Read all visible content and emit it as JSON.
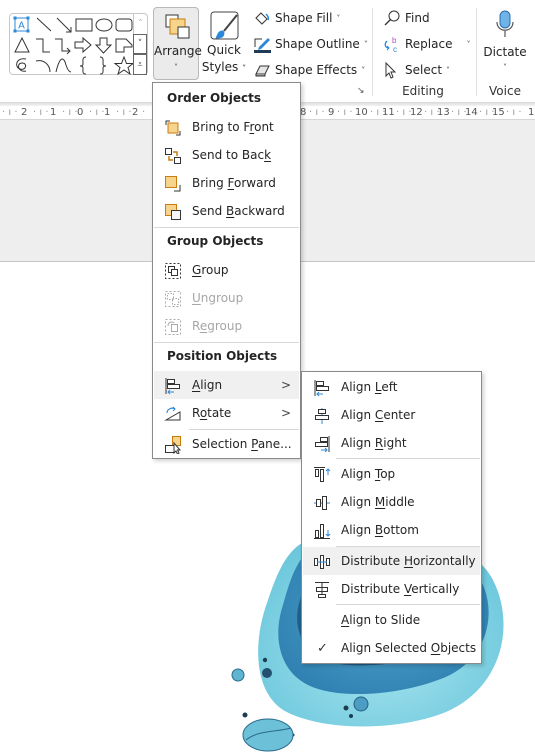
{
  "ribbon": {
    "shape_gallery": {
      "shapes": [
        "text-box",
        "line",
        "arrow",
        "rectangle",
        "oval",
        "rounded-rectangle",
        "triangle",
        "elbow-connector",
        "elbow-arrow-connector",
        "right-arrow",
        "down-arrow",
        "snip-rectangle",
        "freeform-scribble",
        "arc",
        "curve",
        "left-brace",
        "right-brace",
        "star"
      ],
      "scroll_up": "˄",
      "scroll_down": "˅",
      "more": "⩡"
    },
    "arrange": {
      "label": "Arrange",
      "caret": "˅"
    },
    "quick_styles": {
      "label_line1": "Quick",
      "label_line2": "Styles",
      "caret": "˅"
    },
    "shape_fill": {
      "label": "Shape Fill",
      "caret": "˅"
    },
    "shape_outline": {
      "label": "Shape Outline",
      "caret": "˅"
    },
    "shape_effects": {
      "label": "Shape Effects",
      "caret": "˅"
    },
    "find": {
      "label": "Find"
    },
    "replace": {
      "label": "Replace",
      "caret": "˅"
    },
    "select": {
      "label": "Select",
      "caret": "˅"
    },
    "editing_group_label": "Editing",
    "dictate": {
      "label": "Dictate",
      "caret": "˅"
    },
    "voice_group_label": "Voice",
    "launcher_glyph": "↘"
  },
  "ruler": {
    "left_ticks": [
      "2",
      "1",
      "0",
      "1",
      "2"
    ],
    "right_ticks": [
      "8",
      "9",
      "10",
      "11",
      "12",
      "13",
      "14",
      "15",
      "1"
    ]
  },
  "arrange_menu": {
    "sections": [
      {
        "header": "Order Objects",
        "items": [
          {
            "pre": "Bring to F",
            "key": "r",
            "post": "ont",
            "icon": "bring-to-front-icon",
            "enabled": true
          },
          {
            "pre": "Send to Bac",
            "key": "k",
            "post": "",
            "icon": "send-to-back-icon",
            "enabled": true
          },
          {
            "pre": "Bring ",
            "key": "F",
            "post": "orward",
            "icon": "bring-forward-icon",
            "enabled": true
          },
          {
            "pre": "Send ",
            "key": "B",
            "post": "ackward",
            "icon": "send-backward-icon",
            "enabled": true
          }
        ]
      },
      {
        "header": "Group Objects",
        "items": [
          {
            "pre": "",
            "key": "G",
            "post": "roup",
            "icon": "group-icon",
            "enabled": true
          },
          {
            "pre": "",
            "key": "U",
            "post": "ngroup",
            "icon": "ungroup-icon",
            "enabled": false
          },
          {
            "pre": "R",
            "key": "e",
            "post": "group",
            "icon": "regroup-icon",
            "enabled": false
          }
        ]
      },
      {
        "header": "Position Objects",
        "items": [
          {
            "pre": "",
            "key": "A",
            "post": "lign",
            "icon": "align-icon",
            "enabled": true,
            "submenu": true,
            "highlighted": true
          },
          {
            "pre": "R",
            "key": "o",
            "post": "tate",
            "icon": "rotate-icon",
            "enabled": true,
            "submenu": true
          },
          {
            "pre": "Selection ",
            "key": "P",
            "post": "ane...",
            "icon": "selection-pane-icon",
            "enabled": true
          }
        ]
      }
    ],
    "submenu_arrow": ">"
  },
  "align_submenu": {
    "items": [
      {
        "pre": "Align ",
        "key": "L",
        "post": "eft",
        "icon": "align-left-icon"
      },
      {
        "pre": "Align ",
        "key": "C",
        "post": "enter",
        "icon": "align-center-icon"
      },
      {
        "pre": "Align ",
        "key": "R",
        "post": "ight",
        "icon": "align-right-icon"
      },
      {
        "pre": "Align ",
        "key": "T",
        "post": "op",
        "icon": "align-top-icon"
      },
      {
        "pre": "Align ",
        "key": "M",
        "post": "iddle",
        "icon": "align-middle-icon"
      },
      {
        "pre": "Align ",
        "key": "B",
        "post": "ottom",
        "icon": "align-bottom-icon"
      },
      {
        "pre": "Distribute ",
        "key": "H",
        "post": "orizontally",
        "icon": "distribute-horizontally-icon",
        "highlighted": true
      },
      {
        "pre": "Distribute ",
        "key": "V",
        "post": "ertically",
        "icon": "distribute-vertically-icon"
      },
      {
        "pre": "",
        "key": "A",
        "post": "lign to Slide",
        "icon": "",
        "checked": false
      },
      {
        "pre": "Align Selected ",
        "key": "O",
        "post": "bjects",
        "icon": "",
        "checked": true
      }
    ],
    "check_glyph": "✓"
  },
  "colors": {
    "accent_orange": "#f7d48b",
    "orange_stroke": "#c87d0e",
    "accent_blue": "#2b88d8",
    "mic_blue": "#6fb3e8",
    "blob_dark": "#1f5c84",
    "blob_mid": "#3b8dbd",
    "blob_light": "#7fd3e6"
  }
}
